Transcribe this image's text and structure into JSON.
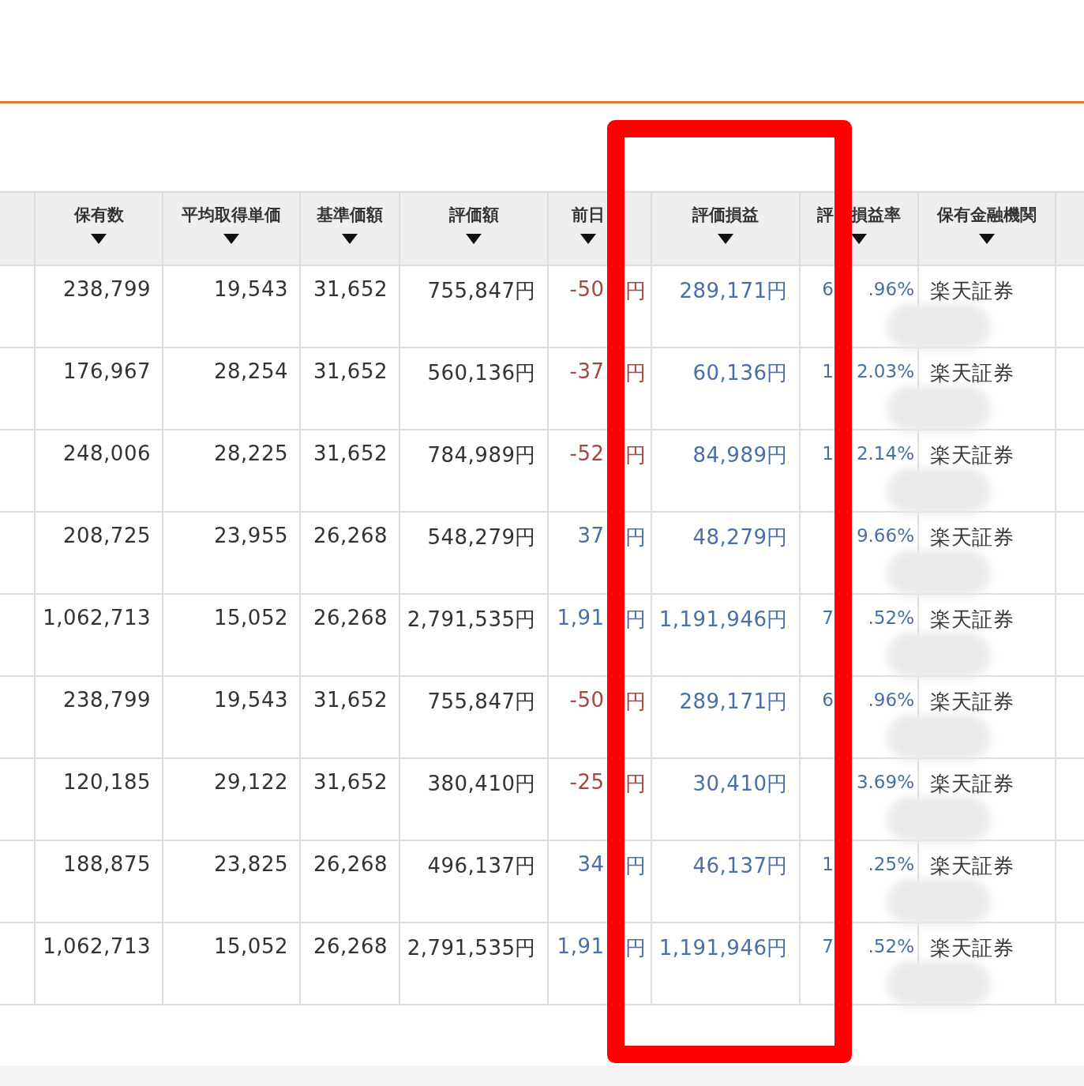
{
  "highlight": {
    "shown": true
  },
  "table": {
    "columns": [
      {
        "kind": "plain",
        "label": "保有数",
        "sortable": true
      },
      {
        "kind": "plain",
        "label": "平均取得単価",
        "sortable": true
      },
      {
        "kind": "plain",
        "label": "基準価額",
        "sortable": true
      },
      {
        "kind": "plain",
        "label": "評価額",
        "sortable": true
      },
      {
        "kind": "cut",
        "label": "前日",
        "sortable": true
      },
      {
        "kind": "plain",
        "label": "評価損益",
        "sortable": true
      },
      {
        "kind": "split",
        "before": "評",
        "after": "損益率",
        "sortable": true
      },
      {
        "kind": "plain",
        "label": "保有金融機関",
        "sortable": true
      }
    ],
    "rows": [
      {
        "holdings": "238,799",
        "avg_cost": "19,543",
        "base_price": "31,652",
        "value": "755,847円",
        "day_change": {
          "shown": "-50",
          "unit": "円",
          "color": "#a6473f"
        },
        "gain": "289,171円",
        "rate": {
          "before": "6",
          "after": ".96%"
        },
        "bank": "楽天証券",
        "redacted": true
      },
      {
        "holdings": "176,967",
        "avg_cost": "28,254",
        "base_price": "31,652",
        "value": "560,136円",
        "day_change": {
          "shown": "-37",
          "unit": "円",
          "color": "#a6473f"
        },
        "gain": "60,136円",
        "rate": {
          "before": "1",
          "after": "2.03%"
        },
        "bank": "楽天証券",
        "redacted": true
      },
      {
        "holdings": "248,006",
        "avg_cost": "28,225",
        "base_price": "31,652",
        "value": "784,989円",
        "day_change": {
          "shown": "-52",
          "unit": "円",
          "color": "#a6473f"
        },
        "gain": "84,989円",
        "rate": {
          "before": "1",
          "after": "2.14%"
        },
        "bank": "楽天証券",
        "redacted": true
      },
      {
        "holdings": "208,725",
        "avg_cost": "23,955",
        "base_price": "26,268",
        "value": "548,279円",
        "day_change": {
          "shown": "37",
          "unit": "円",
          "color": "#4a6fa5"
        },
        "gain": "48,279円",
        "rate": {
          "after": "9.66%"
        },
        "bank": "楽天証券",
        "redacted": true
      },
      {
        "holdings": "1,062,713",
        "avg_cost": "15,052",
        "base_price": "26,268",
        "value": "2,791,535円",
        "day_change": {
          "shown": "1,91",
          "unit": "円",
          "color": "#4a6fa5"
        },
        "gain": "1,191,946円",
        "rate": {
          "before": "7",
          "after": ".52%"
        },
        "bank": "楽天証券",
        "redacted": true
      },
      {
        "holdings": "238,799",
        "avg_cost": "19,543",
        "base_price": "31,652",
        "value": "755,847円",
        "day_change": {
          "shown": "-50",
          "unit": "円",
          "color": "#a6473f"
        },
        "gain": "289,171円",
        "rate": {
          "before": "6",
          "after": ".96%"
        },
        "bank": "楽天証券",
        "redacted": true
      },
      {
        "holdings": "120,185",
        "avg_cost": "29,122",
        "base_price": "31,652",
        "value": "380,410円",
        "day_change": {
          "shown": "-25",
          "unit": "円",
          "color": "#a6473f"
        },
        "gain": "30,410円",
        "rate": {
          "after": "3.69%"
        },
        "bank": "楽天証券",
        "redacted": true
      },
      {
        "holdings": "188,875",
        "avg_cost": "23,825",
        "base_price": "26,268",
        "value": "496,137円",
        "day_change": {
          "shown": "34",
          "unit": "円",
          "color": "#4a6fa5"
        },
        "gain": "46,137円",
        "rate": {
          "before": "1",
          "after": ".25%"
        },
        "bank": "楽天証券",
        "redacted": true
      },
      {
        "holdings": "1,062,713",
        "avg_cost": "15,052",
        "base_price": "26,268",
        "value": "2,791,535円",
        "day_change": {
          "shown": "1,91",
          "unit": "円",
          "color": "#4a6fa5"
        },
        "gain": "1,191,946円",
        "rate": {
          "before": "7",
          "after": ".52%"
        },
        "bank": "楽天証券",
        "redacted": true
      }
    ]
  }
}
